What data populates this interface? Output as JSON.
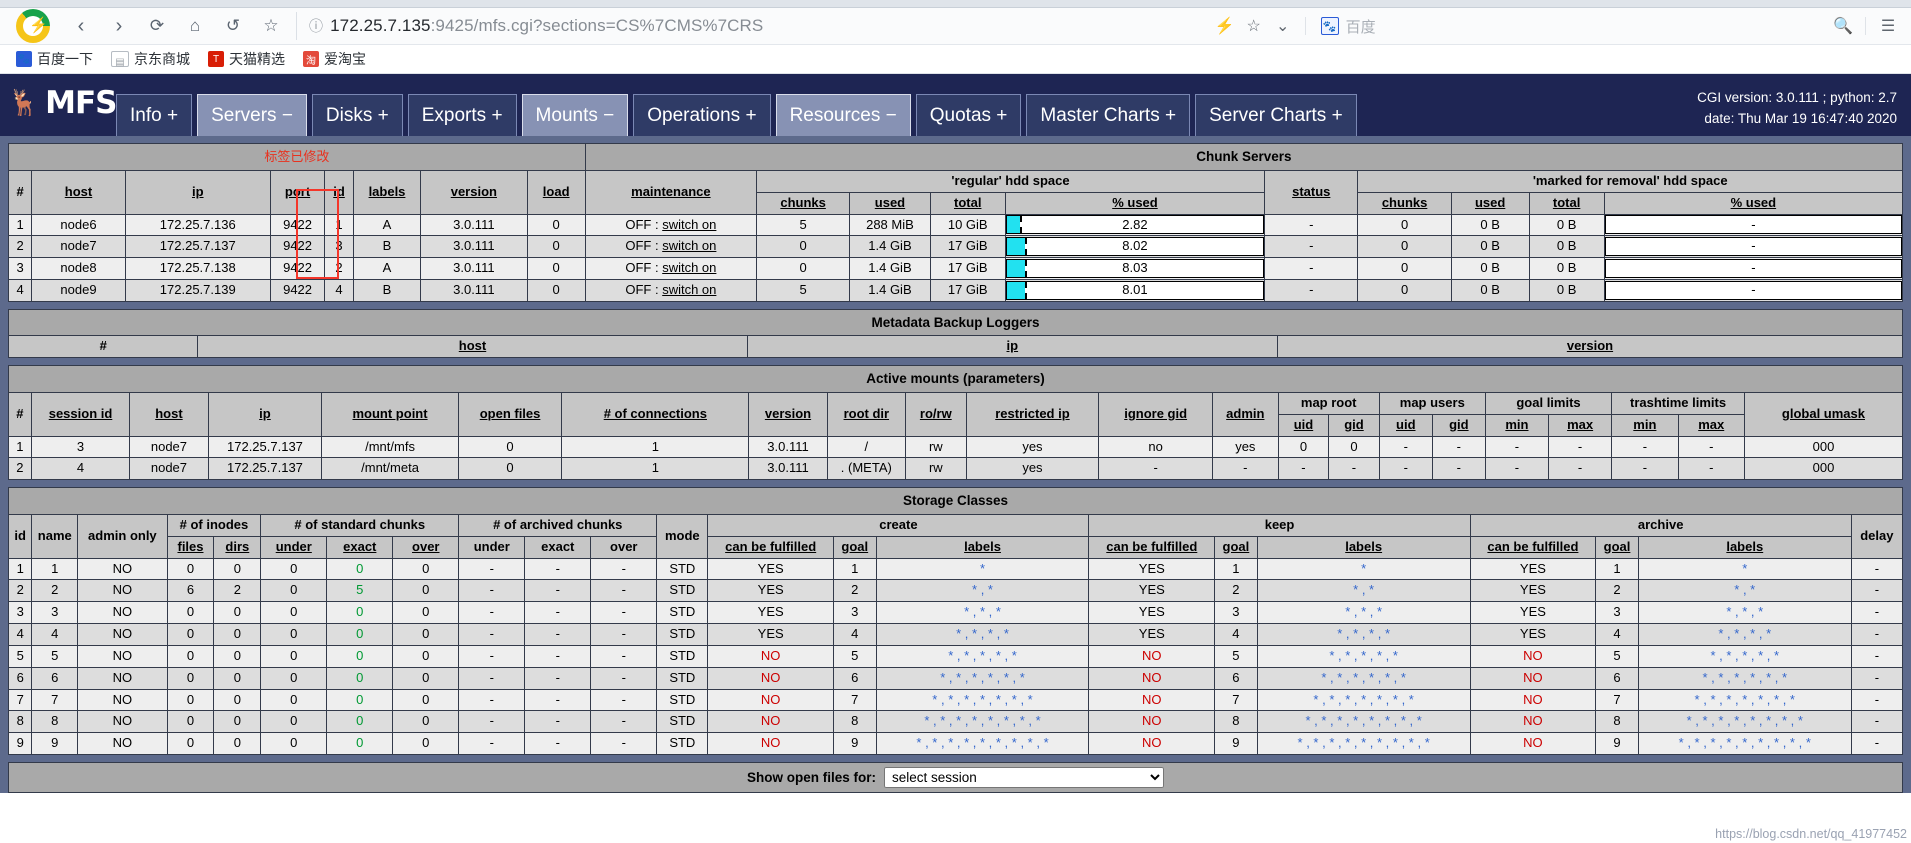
{
  "browser": {
    "url_host": "172.25.7.135",
    "url_rest": ":9425/mfs.cgi?sections=CS%7CMS%7CRS",
    "lock_icon": "info-circle-icon",
    "back_icon": "back-arrow-icon",
    "forward_icon": "forward-arrow-icon",
    "reload_icon": "reload-icon",
    "home_icon": "home-icon",
    "undo_icon": "undo-icon",
    "star_icon": "star-icon",
    "lightning_icon": "lightning-icon",
    "bookmark_star_icon": "star-outline-icon",
    "chevron_icon": "chevron-down-icon",
    "search_icon": "search-icon",
    "menu_icon": "hamburger-menu-icon",
    "search_engine": "百度",
    "bookmarks": [
      {
        "label": "百度一下",
        "icon": "baidu-icon"
      },
      {
        "label": "京东商城",
        "icon": "page-icon"
      },
      {
        "label": "天猫精选",
        "icon": "tmall-icon"
      },
      {
        "label": "爱淘宝",
        "icon": "taobao-icon"
      }
    ]
  },
  "header": {
    "brand": "MFS",
    "moose_icon": "moose-logo-icon",
    "cgi_version_line": "CGI version: 3.0.111 ; python: 2.7",
    "date_line": "date: Thu Mar 19 16:47:40 2020",
    "tabs": [
      {
        "label": "Info +",
        "active": false
      },
      {
        "label": "Servers −",
        "active": true
      },
      {
        "label": "Disks +",
        "active": false
      },
      {
        "label": "Exports +",
        "active": false
      },
      {
        "label": "Mounts −",
        "active": true
      },
      {
        "label": "Operations +",
        "active": false
      },
      {
        "label": "Resources −",
        "active": true
      },
      {
        "label": "Quotas +",
        "active": false
      },
      {
        "label": "Master Charts +",
        "active": false
      },
      {
        "label": "Server Charts +",
        "active": false
      }
    ]
  },
  "chunk_servers": {
    "title": "Chunk Servers",
    "annotation": "标签已修改",
    "group_regular": "'regular' hdd space",
    "group_removal": "'marked for removal' hdd space",
    "headers": {
      "num": "#",
      "host": "host",
      "ip": "ip",
      "port": "port",
      "id": "id",
      "labels": "labels",
      "version": "version",
      "load": "load",
      "maintenance": "maintenance",
      "chunks": "chunks",
      "used": "used",
      "total": "total",
      "pctused": "% used",
      "status": "status",
      "r_chunks": "chunks",
      "r_used": "used",
      "r_total": "total",
      "r_pct": "% used"
    },
    "rows": [
      {
        "n": "1",
        "host": "node6",
        "ip": "172.25.7.136",
        "port": "9422",
        "id": "1",
        "labels": "A",
        "version": "3.0.111",
        "load": "0",
        "maint_off": "OFF :",
        "maint_link": "switch on",
        "chunks": "5",
        "used": "288 MiB",
        "total": "10 GiB",
        "pct": "2.82",
        "pct_val": 2.82,
        "status": "-",
        "r_chunks": "0",
        "r_used": "0 B",
        "r_total": "0 B",
        "r_pct": "-"
      },
      {
        "n": "2",
        "host": "node7",
        "ip": "172.25.7.137",
        "port": "9422",
        "id": "3",
        "labels": "B",
        "version": "3.0.111",
        "load": "0",
        "maint_off": "OFF :",
        "maint_link": "switch on",
        "chunks": "0",
        "used": "1.4 GiB",
        "total": "17 GiB",
        "pct": "8.02",
        "pct_val": 8.02,
        "status": "-",
        "r_chunks": "0",
        "r_used": "0 B",
        "r_total": "0 B",
        "r_pct": "-"
      },
      {
        "n": "3",
        "host": "node8",
        "ip": "172.25.7.138",
        "port": "9422",
        "id": "2",
        "labels": "A",
        "version": "3.0.111",
        "load": "0",
        "maint_off": "OFF :",
        "maint_link": "switch on",
        "chunks": "0",
        "used": "1.4 GiB",
        "total": "17 GiB",
        "pct": "8.03",
        "pct_val": 8.03,
        "status": "-",
        "r_chunks": "0",
        "r_used": "0 B",
        "r_total": "0 B",
        "r_pct": "-"
      },
      {
        "n": "4",
        "host": "node9",
        "ip": "172.25.7.139",
        "port": "9422",
        "id": "4",
        "labels": "B",
        "version": "3.0.111",
        "load": "0",
        "maint_off": "OFF :",
        "maint_link": "switch on",
        "chunks": "5",
        "used": "1.4 GiB",
        "total": "17 GiB",
        "pct": "8.01",
        "pct_val": 8.01,
        "status": "-",
        "r_chunks": "0",
        "r_used": "0 B",
        "r_total": "0 B",
        "r_pct": "-"
      }
    ]
  },
  "backup_loggers": {
    "title": "Metadata Backup Loggers",
    "headers": {
      "num": "#",
      "host": "host",
      "ip": "ip",
      "version": "version"
    }
  },
  "active_mounts": {
    "title": "Active mounts (parameters)",
    "groups": {
      "map_root": "map root",
      "map_users": "map users",
      "goal_limits": "goal limits",
      "trashtime_limits": "trashtime limits"
    },
    "headers": {
      "num": "#",
      "session_id": "session id",
      "host": "host",
      "ip": "ip",
      "mount_point": "mount point",
      "open_files": "open files",
      "connections": "# of connections",
      "version": "version",
      "root_dir": "root dir",
      "rorw": "ro/rw",
      "restricted_ip": "restricted ip",
      "ignore_gid": "ignore gid",
      "admin": "admin",
      "mr_uid": "uid",
      "mr_gid": "gid",
      "mu_uid": "uid",
      "mu_gid": "gid",
      "gl_min": "min",
      "gl_max": "max",
      "tl_min": "min",
      "tl_max": "max",
      "global_umask": "global umask"
    },
    "rows": [
      {
        "n": "1",
        "session": "3",
        "host": "node7",
        "ip": "172.25.7.137",
        "mount": "/mnt/mfs",
        "open_files": "0",
        "conns": "1",
        "version": "3.0.111",
        "root_dir": "/",
        "rorw": "rw",
        "restricted": "yes",
        "ignore_gid": "no",
        "admin": "yes",
        "mr_uid": "0",
        "mr_gid": "0",
        "mu_uid": "-",
        "mu_gid": "-",
        "gl_min": "-",
        "gl_max": "-",
        "tl_min": "-",
        "tl_max": "-",
        "umask": "000"
      },
      {
        "n": "2",
        "session": "4",
        "host": "node7",
        "ip": "172.25.7.137",
        "mount": "/mnt/meta",
        "open_files": "0",
        "conns": "1",
        "version": "3.0.111",
        "root_dir": ". (META)",
        "rorw": "rw",
        "restricted": "yes",
        "ignore_gid": "-",
        "admin": "-",
        "mr_uid": "-",
        "mr_gid": "-",
        "mu_uid": "-",
        "mu_gid": "-",
        "gl_min": "-",
        "gl_max": "-",
        "tl_min": "-",
        "tl_max": "-",
        "umask": "000"
      }
    ]
  },
  "storage_classes": {
    "title": "Storage Classes",
    "groups": {
      "inodes": "# of inodes",
      "standard": "# of standard chunks",
      "archived": "# of archived chunks",
      "create": "create",
      "keep": "keep",
      "archive": "archive"
    },
    "headers": {
      "id": "id",
      "name": "name",
      "admin_only": "admin only",
      "files": "files",
      "dirs": "dirs",
      "s_under": "under",
      "s_exact": "exact",
      "s_over": "over",
      "a_under": "under",
      "a_exact": "exact",
      "a_over": "over",
      "mode": "mode",
      "c_fulfilled": "can be fulfilled",
      "c_goal": "goal",
      "c_labels": "labels",
      "k_fulfilled": "can be fulfilled",
      "k_goal": "goal",
      "k_labels": "labels",
      "ar_fulfilled": "can be fulfilled",
      "ar_goal": "goal",
      "ar_labels": "labels",
      "delay": "delay"
    },
    "rows": [
      {
        "id": "1",
        "name": "1",
        "admin_only": "NO",
        "files": "0",
        "dirs": "0",
        "s_under": "0",
        "s_exact": "0",
        "s_over": "0",
        "a_under": "-",
        "a_exact": "-",
        "a_over": "-",
        "mode": "STD",
        "c_ful": "YES",
        "c_goal": "1",
        "c_labels": "*",
        "k_ful": "YES",
        "k_goal": "1",
        "k_labels": "*",
        "ar_ful": "YES",
        "ar_goal": "1",
        "ar_labels": "*",
        "delay": "-"
      },
      {
        "id": "2",
        "name": "2",
        "admin_only": "NO",
        "files": "6",
        "dirs": "2",
        "s_under": "0",
        "s_exact": "5",
        "s_over": "0",
        "a_under": "-",
        "a_exact": "-",
        "a_over": "-",
        "mode": "STD",
        "c_ful": "YES",
        "c_goal": "2",
        "c_labels": "* , *",
        "k_ful": "YES",
        "k_goal": "2",
        "k_labels": "* , *",
        "ar_ful": "YES",
        "ar_goal": "2",
        "ar_labels": "* , *",
        "delay": "-"
      },
      {
        "id": "3",
        "name": "3",
        "admin_only": "NO",
        "files": "0",
        "dirs": "0",
        "s_under": "0",
        "s_exact": "0",
        "s_over": "0",
        "a_under": "-",
        "a_exact": "-",
        "a_over": "-",
        "mode": "STD",
        "c_ful": "YES",
        "c_goal": "3",
        "c_labels": "* , * , *",
        "k_ful": "YES",
        "k_goal": "3",
        "k_labels": "* , * , *",
        "ar_ful": "YES",
        "ar_goal": "3",
        "ar_labels": "* , * , *",
        "delay": "-"
      },
      {
        "id": "4",
        "name": "4",
        "admin_only": "NO",
        "files": "0",
        "dirs": "0",
        "s_under": "0",
        "s_exact": "0",
        "s_over": "0",
        "a_under": "-",
        "a_exact": "-",
        "a_over": "-",
        "mode": "STD",
        "c_ful": "YES",
        "c_goal": "4",
        "c_labels": "* , * , * , *",
        "k_ful": "YES",
        "k_goal": "4",
        "k_labels": "* , * , * , *",
        "ar_ful": "YES",
        "ar_goal": "4",
        "ar_labels": "* , * , * , *",
        "delay": "-"
      },
      {
        "id": "5",
        "name": "5",
        "admin_only": "NO",
        "files": "0",
        "dirs": "0",
        "s_under": "0",
        "s_exact": "0",
        "s_over": "0",
        "a_under": "-",
        "a_exact": "-",
        "a_over": "-",
        "mode": "STD",
        "c_ful": "NO",
        "c_goal": "5",
        "c_labels": "* , * , * , * , *",
        "k_ful": "NO",
        "k_goal": "5",
        "k_labels": "* , * , * , * , *",
        "ar_ful": "NO",
        "ar_goal": "5",
        "ar_labels": "* , * , * , * , *",
        "delay": "-"
      },
      {
        "id": "6",
        "name": "6",
        "admin_only": "NO",
        "files": "0",
        "dirs": "0",
        "s_under": "0",
        "s_exact": "0",
        "s_over": "0",
        "a_under": "-",
        "a_exact": "-",
        "a_over": "-",
        "mode": "STD",
        "c_ful": "NO",
        "c_goal": "6",
        "c_labels": "* , * , * , * , * , *",
        "k_ful": "NO",
        "k_goal": "6",
        "k_labels": "* , * , * , * , * , *",
        "ar_ful": "NO",
        "ar_goal": "6",
        "ar_labels": "* , * , * , * , * , *",
        "delay": "-"
      },
      {
        "id": "7",
        "name": "7",
        "admin_only": "NO",
        "files": "0",
        "dirs": "0",
        "s_under": "0",
        "s_exact": "0",
        "s_over": "0",
        "a_under": "-",
        "a_exact": "-",
        "a_over": "-",
        "mode": "STD",
        "c_ful": "NO",
        "c_goal": "7",
        "c_labels": "* , * , * , * , * , * , *",
        "k_ful": "NO",
        "k_goal": "7",
        "k_labels": "* , * , * , * , * , * , *",
        "ar_ful": "NO",
        "ar_goal": "7",
        "ar_labels": "* , * , * , * , * , * , *",
        "delay": "-"
      },
      {
        "id": "8",
        "name": "8",
        "admin_only": "NO",
        "files": "0",
        "dirs": "0",
        "s_under": "0",
        "s_exact": "0",
        "s_over": "0",
        "a_under": "-",
        "a_exact": "-",
        "a_over": "-",
        "mode": "STD",
        "c_ful": "NO",
        "c_goal": "8",
        "c_labels": "* , * , * , * , * , * , * , *",
        "k_ful": "NO",
        "k_goal": "8",
        "k_labels": "* , * , * , * , * , * , * , *",
        "ar_ful": "NO",
        "ar_goal": "8",
        "ar_labels": "* , * , * , * , * , * , * , *",
        "delay": "-"
      },
      {
        "id": "9",
        "name": "9",
        "admin_only": "NO",
        "files": "0",
        "dirs": "0",
        "s_under": "0",
        "s_exact": "0",
        "s_over": "0",
        "a_under": "-",
        "a_exact": "-",
        "a_over": "-",
        "mode": "STD",
        "c_ful": "NO",
        "c_goal": "9",
        "c_labels": "* , * , * , * , * , * , * , * , *",
        "k_ful": "NO",
        "k_goal": "9",
        "k_labels": "* , * , * , * , * , * , * , * , *",
        "ar_ful": "NO",
        "ar_goal": "9",
        "ar_labels": "* , * , * , * , * , * , * , * , *",
        "delay": "-"
      }
    ]
  },
  "footer": {
    "label": "Show open files for:",
    "selected": "select session"
  },
  "watermark": "https://blog.csdn.net/qq_41977452"
}
